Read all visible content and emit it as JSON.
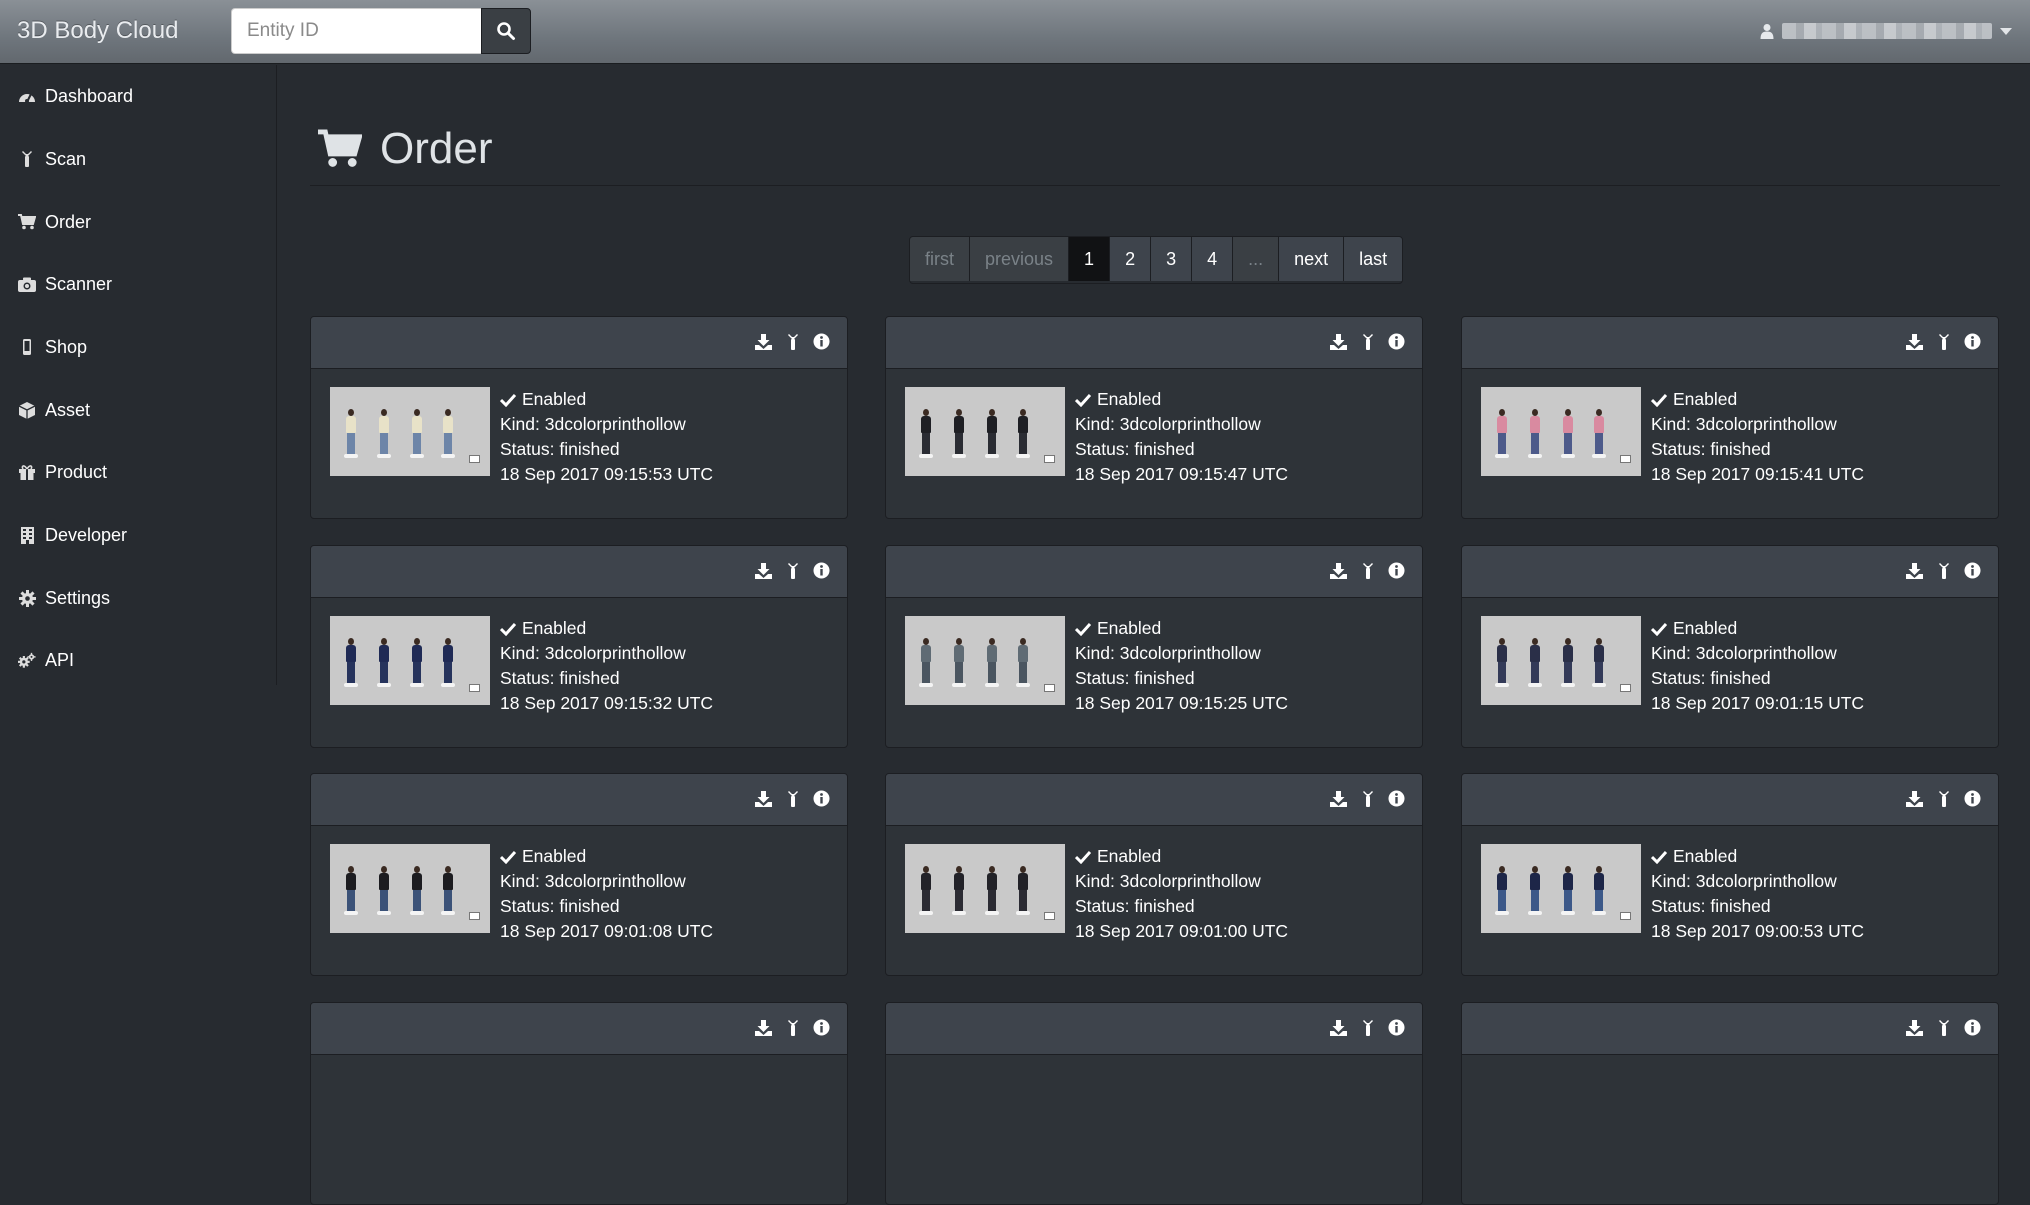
{
  "navbar": {
    "brand": "3D Body Cloud",
    "search": {
      "placeholder": "Entity ID",
      "value": ""
    },
    "user_menu": {
      "icon": "user-icon",
      "caret": "caret-down-icon"
    }
  },
  "sidebar": {
    "items": [
      {
        "label": "Dashboard",
        "icon": "tachometer-icon"
      },
      {
        "label": "Scan",
        "icon": "scan-figure-icon"
      },
      {
        "label": "Order",
        "icon": "shopping-cart-icon"
      },
      {
        "label": "Scanner",
        "icon": "camera-icon"
      },
      {
        "label": "Shop",
        "icon": "mobile-icon"
      },
      {
        "label": "Asset",
        "icon": "cube-icon"
      },
      {
        "label": "Product",
        "icon": "gift-icon"
      },
      {
        "label": "Developer",
        "icon": "building-icon"
      },
      {
        "label": "Settings",
        "icon": "gear-icon"
      },
      {
        "label": "API",
        "icon": "gears-icon"
      }
    ]
  },
  "page": {
    "title": "Order",
    "icon": "shopping-cart-icon"
  },
  "pagination": {
    "first": "first",
    "previous": "previous",
    "pages": [
      "1",
      "2",
      "3",
      "4"
    ],
    "ellipsis": "...",
    "next": "next",
    "last": "last",
    "current": "1"
  },
  "orders": [
    {
      "status_flag": "Enabled",
      "kind": "Kind: 3dcolorprinthollow",
      "status": "Status: finished",
      "timestamp": "18 Sep 2017 09:15:53 UTC"
    },
    {
      "status_flag": "Enabled",
      "kind": "Kind: 3dcolorprinthollow",
      "status": "Status: finished",
      "timestamp": "18 Sep 2017 09:15:47 UTC"
    },
    {
      "status_flag": "Enabled",
      "kind": "Kind: 3dcolorprinthollow",
      "status": "Status: finished",
      "timestamp": "18 Sep 2017 09:15:41 UTC"
    },
    {
      "status_flag": "Enabled",
      "kind": "Kind: 3dcolorprinthollow",
      "status": "Status: finished",
      "timestamp": "18 Sep 2017 09:15:32 UTC"
    },
    {
      "status_flag": "Enabled",
      "kind": "Kind: 3dcolorprinthollow",
      "status": "Status: finished",
      "timestamp": "18 Sep 2017 09:15:25 UTC"
    },
    {
      "status_flag": "Enabled",
      "kind": "Kind: 3dcolorprinthollow",
      "status": "Status: finished",
      "timestamp": "18 Sep 2017 09:01:15 UTC"
    },
    {
      "status_flag": "Enabled",
      "kind": "Kind: 3dcolorprinthollow",
      "status": "Status: finished",
      "timestamp": "18 Sep 2017 09:01:08 UTC"
    },
    {
      "status_flag": "Enabled",
      "kind": "Kind: 3dcolorprinthollow",
      "status": "Status: finished",
      "timestamp": "18 Sep 2017 09:01:00 UTC"
    },
    {
      "status_flag": "Enabled",
      "kind": "Kind: 3dcolorprinthollow",
      "status": "Status: finished",
      "timestamp": "18 Sep 2017 09:00:53 UTC"
    }
  ],
  "card_actions": [
    "download-icon",
    "scan-figure-icon",
    "info-circle-icon"
  ],
  "colors": {
    "background": "#272b30",
    "card": "#2e3338",
    "card_header": "#3e444c",
    "text": "#ffffff"
  }
}
